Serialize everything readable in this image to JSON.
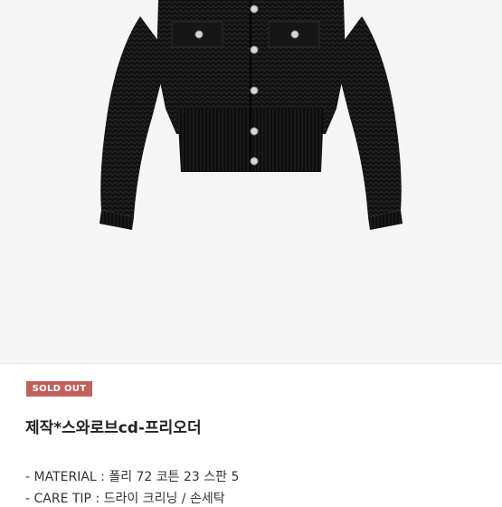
{
  "product": {
    "image_alt": "black knit cropped jacket with jewel buttons",
    "status_badge": "SOLD OUT",
    "title": "제작*스와로브cd-프리오더",
    "details": [
      "- MATERIAL : 폴리 72 코튼 23 스판 5",
      "- CARE TIP : 드라이 크리닝 / 손세탁"
    ]
  },
  "colors": {
    "badge_background": "#c0625b",
    "photo_background": "#f5f5f5",
    "jacket": "#111111"
  }
}
